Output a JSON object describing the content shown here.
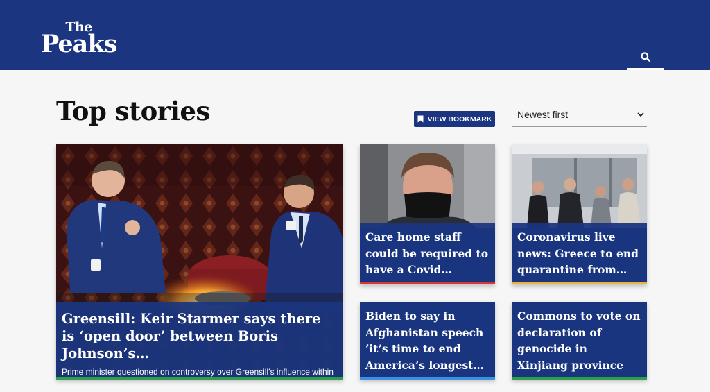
{
  "header": {
    "logo_line1": "The",
    "logo_line2": "Peaks",
    "search_icon": "search-icon",
    "background": "#1b3580"
  },
  "main": {
    "title": "Top stories",
    "bookmark_button": {
      "icon": "bookmark-icon",
      "label": "VIEW BOOKMARK"
    },
    "sort": {
      "selected": "Newest first",
      "icon": "chevron-down-icon"
    }
  },
  "stories": [
    {
      "headline": "Greensill: Keir Starmer says there is ‘open door’ between Boris Johnson’s…",
      "summary": "Prime minister questioned on controversy over Greensill’s influence within government with links to David Cameron and a senior civil servant",
      "accent": "#2e9e4a"
    },
    {
      "headline": "Care home staff could be required to have a Covid…",
      "accent": "#d93434"
    },
    {
      "headline": "Coronavirus live news: Greece to end quarantine from…",
      "accent": "#e8b43a"
    },
    {
      "headline": "Biden to say in Afghanistan speech ‘it’s time to end America’s longest…",
      "accent": "#3d8fe0"
    },
    {
      "headline": "Commons to vote on declaration of genocide in Xinjiang province",
      "accent": "#2e9e4a"
    }
  ]
}
